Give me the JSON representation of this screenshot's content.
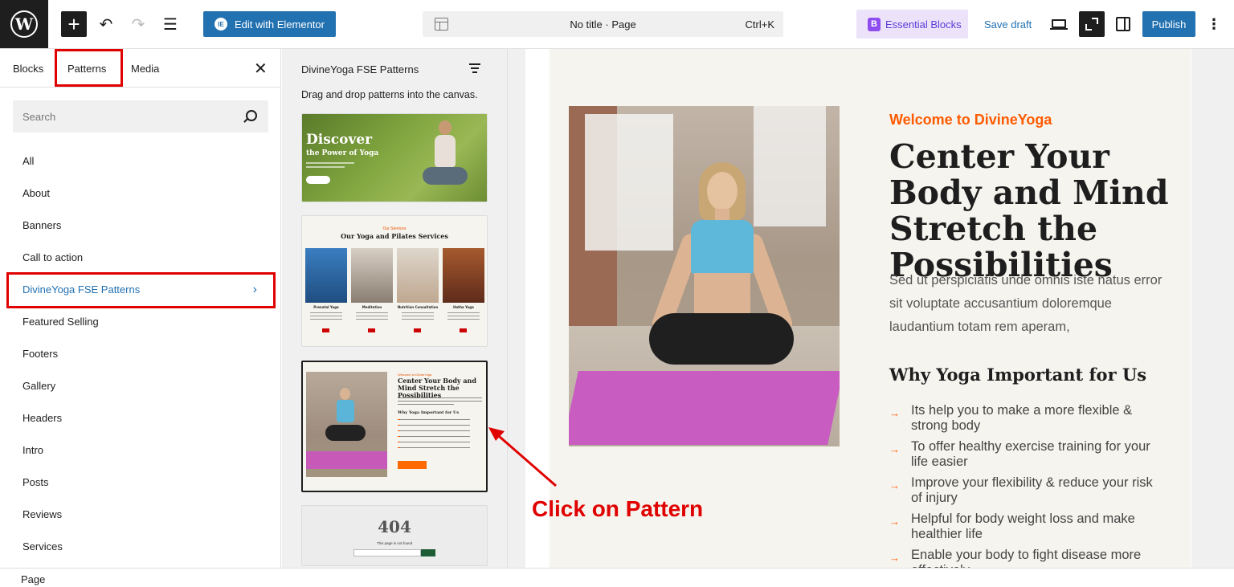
{
  "toolbar": {
    "elementor_label": "Edit with Elementor",
    "elementor_icon": "IE",
    "doc_title": "No title · Page",
    "shortcut": "Ctrl+K",
    "essential_blocks_label": "Essential Blocks",
    "save_draft_label": "Save draft",
    "publish_label": "Publish"
  },
  "inserter": {
    "tabs": [
      "Blocks",
      "Patterns",
      "Media"
    ],
    "search_placeholder": "Search",
    "categories": [
      "All",
      "About",
      "Banners",
      "Call to action",
      "DivineYoga FSE Patterns",
      "Featured Selling",
      "Footers",
      "Gallery",
      "Headers",
      "Intro",
      "Posts",
      "Reviews",
      "Services"
    ],
    "active_category": "DivineYoga FSE Patterns"
  },
  "patterns_panel": {
    "title": "DivineYoga FSE Patterns",
    "description": "Drag and drop patterns into the canvas.",
    "card1": {
      "line1": "Discover",
      "line2": "the Power of Yoga"
    },
    "card2": {
      "subtitle": "Our Services",
      "heading": "Our Yoga and Pilates Services",
      "labels": [
        "Prenatal Yoga",
        "Meditation",
        "Nutrition Consultation",
        "Hatha Yoga"
      ]
    },
    "card3": {
      "subtitle": "Welcome to DivineYoga",
      "heading": "Center Your Body and Mind Stretch the Possibilities",
      "subheading": "Why Yoga Important for Us"
    },
    "card4": {
      "code": "404",
      "text": "This page is not found"
    }
  },
  "canvas": {
    "welcome": "Welcome to DivineYoga",
    "headline": "Center Your Body and Mind Stretch the Possibilities",
    "paragraph": "Sed ut perspiciatis unde omnis iste natus error sit voluptate accusantium doloremque laudantium totam rem aperam,",
    "why_heading": "Why Yoga Important for Us",
    "benefits": [
      "Its help you to make a more flexible & strong body",
      "To offer healthy exercise training for your life easier",
      "Improve your flexibility & reduce your risk of injury",
      "Helpful for body weight loss and make healthier life",
      "Enable your body to fight disease more effectively"
    ],
    "accent_color": "#ff5a00"
  },
  "annotation": {
    "text": "Click on Pattern",
    "color": "#e00000"
  },
  "statusbar": {
    "label": "Page"
  }
}
